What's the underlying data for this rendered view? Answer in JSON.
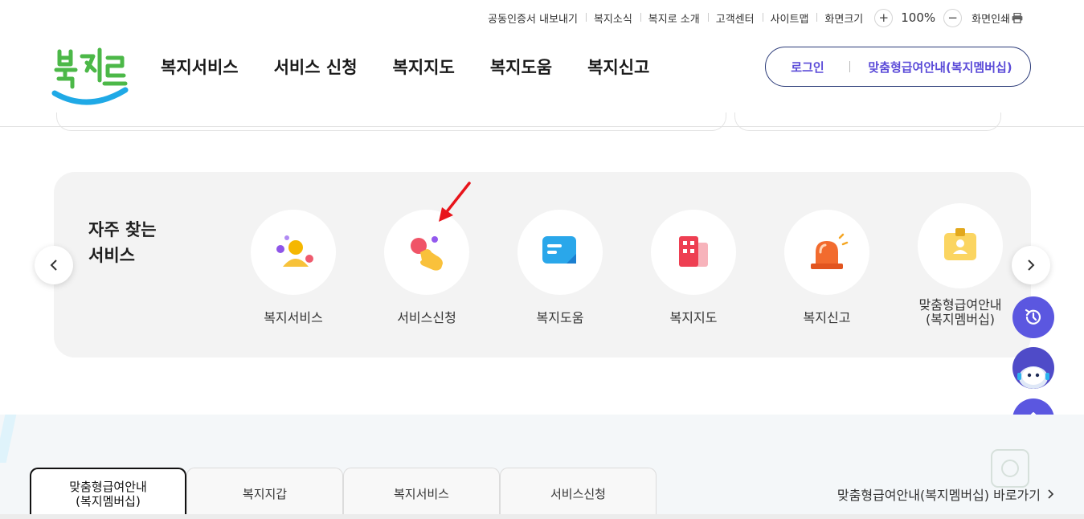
{
  "utility": {
    "links": [
      "공동인증서 내보내기",
      "복지소식",
      "복지로 소개",
      "고객센터",
      "사이트맵",
      "화면크기"
    ],
    "zoom_in": "+",
    "zoom_value": "100%",
    "zoom_out": "−",
    "print": "화면인쇄"
  },
  "header": {
    "logo_text": "복지로",
    "nav": [
      "복지서비스",
      "서비스 신청",
      "복지지도",
      "복지도움",
      "복지신고"
    ],
    "login": "로그인",
    "membership": "맞춤형급여안내(복지멤버십)"
  },
  "frequent": {
    "title": "자주 찾는\n서비스",
    "prev_icon": "chevron-left-icon",
    "next_icon": "chevron-right-icon",
    "items": [
      {
        "label": "복지서비스",
        "icon": "people-icon"
      },
      {
        "label": "서비스신청",
        "icon": "hand-tap-icon"
      },
      {
        "label": "복지도움",
        "icon": "chat-card-icon"
      },
      {
        "label": "복지지도",
        "icon": "map-building-icon"
      },
      {
        "label": "복지신고",
        "icon": "siren-icon"
      },
      {
        "label": "맞춤형급여안내\n(복지멤버십)",
        "icon": "id-badge-icon"
      }
    ]
  },
  "floating": {
    "history_icon": "history-icon",
    "chatbot_icon": "chatbot-icon",
    "top_icon": "arrow-up-icon"
  },
  "tabs": [
    {
      "label": "맞춤형급여안내\n(복지멤버십)",
      "active": true
    },
    {
      "label": "복지지갑",
      "active": false
    },
    {
      "label": "복지서비스",
      "active": false
    },
    {
      "label": "서비스신청",
      "active": false
    }
  ],
  "goto_link": "맞춤형급여안내(복지멤버십) 바로가기",
  "colors": {
    "brand_purple": "#5b4bd8",
    "brand_navy": "#2a3a78",
    "logo_green": "#4cb848",
    "logo_blue": "#1fa9e6",
    "float_purple": "#5b57e0",
    "annotation_red": "#e8141b"
  }
}
